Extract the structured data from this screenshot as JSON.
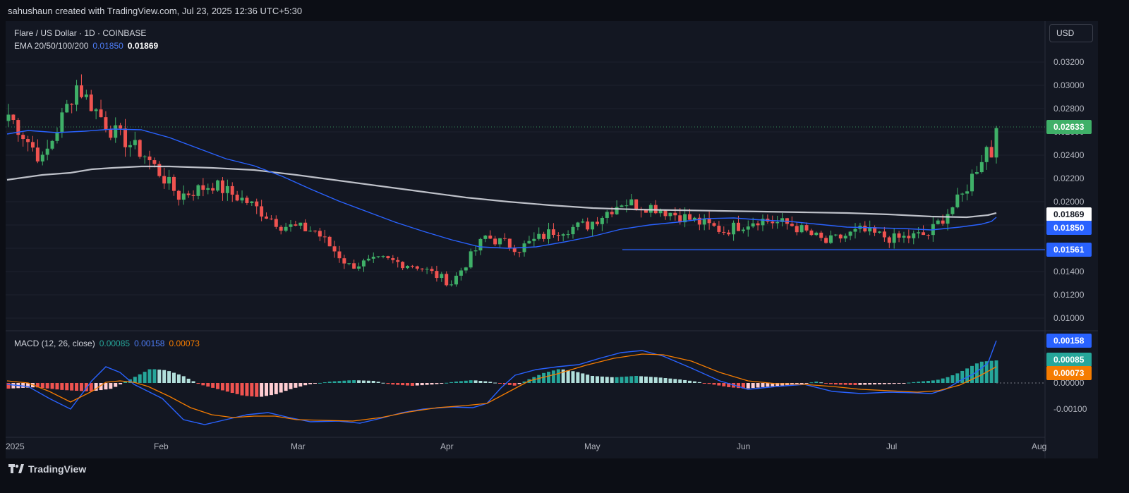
{
  "header": {
    "attribution": "sahushaun created with TradingView.com, Jul 23, 2025 12:36 UTC+5:30"
  },
  "price_pane": {
    "title": "Flare / US Dollar · 1D · COINBASE",
    "ema_label": "EMA 20/50/100/200",
    "ema_value_1": "0.01850",
    "ema_value_2": "0.01869",
    "currency_button": "USD",
    "axis_ticks": [
      "0.03200",
      "0.03000",
      "0.02800",
      "0.02600",
      "0.02400",
      "0.02200",
      "0.02000",
      "0.01800",
      "0.01600",
      "0.01400",
      "0.01200",
      "0.01000"
    ],
    "tags": {
      "last_price": "0.02633",
      "ema_200": "0.01869",
      "ema_50": "0.01850",
      "support": "0.01561"
    }
  },
  "macd_pane": {
    "label": "MACD (12, 26, close)",
    "hist_value": "0.00085",
    "macd_value": "0.00158",
    "signal_value": "0.00073",
    "axis_ticks": [
      "0.00100",
      "0.00000",
      "-0.00100"
    ],
    "tags": {
      "macd": "0.00158",
      "hist": "0.00085",
      "signal": "0.00073"
    }
  },
  "time_axis": [
    "2025",
    "Feb",
    "Mar",
    "Apr",
    "May",
    "Jun",
    "Jul",
    "Aug"
  ],
  "footer": {
    "logo_text": "TradingView"
  },
  "colors": {
    "up": "#26a69a",
    "up_candle": "#3fb068",
    "down": "#ef5350",
    "ema_blue": "#2962ff",
    "ema_white": "#d1d4dc",
    "signal_orange": "#f57c00",
    "support_line": "#2962ff"
  },
  "chart_data": {
    "type": "candlestick",
    "title": "Flare / US Dollar · 1D · COINBASE",
    "x_range": [
      "2025-01-01",
      "2025-07-23"
    ],
    "y_range": [
      0.009,
      0.0333
    ],
    "support_level": 0.01561,
    "last_close": 0.02633,
    "ema_series": [
      {
        "name": "EMA 50",
        "value": 0.0185
      },
      {
        "name": "EMA 200",
        "value": 0.01869
      }
    ],
    "candles_sampled": [
      {
        "date": "2025-01-01",
        "open": 0.027,
        "high": 0.0282,
        "low": 0.0262,
        "close": 0.0275
      },
      {
        "date": "2025-01-08",
        "open": 0.0275,
        "high": 0.028,
        "low": 0.0225,
        "close": 0.0235
      },
      {
        "date": "2025-01-15",
        "open": 0.024,
        "high": 0.033,
        "low": 0.0235,
        "close": 0.03
      },
      {
        "date": "2025-01-22",
        "open": 0.0295,
        "high": 0.03,
        "low": 0.025,
        "close": 0.0262
      },
      {
        "date": "2025-01-29",
        "open": 0.0262,
        "high": 0.029,
        "low": 0.023,
        "close": 0.024
      },
      {
        "date": "2025-02-05",
        "open": 0.024,
        "high": 0.0245,
        "low": 0.0175,
        "close": 0.0205
      },
      {
        "date": "2025-02-12",
        "open": 0.0205,
        "high": 0.0225,
        "low": 0.0195,
        "close": 0.0215
      },
      {
        "date": "2025-02-19",
        "open": 0.0215,
        "high": 0.023,
        "low": 0.02,
        "close": 0.02
      },
      {
        "date": "2025-02-26",
        "open": 0.02,
        "high": 0.0205,
        "low": 0.0175,
        "close": 0.018
      },
      {
        "date": "2025-03-05",
        "open": 0.018,
        "high": 0.0195,
        "low": 0.017,
        "close": 0.0175
      },
      {
        "date": "2025-03-12",
        "open": 0.0175,
        "high": 0.018,
        "low": 0.014,
        "close": 0.0145
      },
      {
        "date": "2025-03-19",
        "open": 0.0145,
        "high": 0.0155,
        "low": 0.014,
        "close": 0.015
      },
      {
        "date": "2025-03-26",
        "open": 0.015,
        "high": 0.0152,
        "low": 0.014,
        "close": 0.0145
      },
      {
        "date": "2025-04-02",
        "open": 0.0145,
        "high": 0.015,
        "low": 0.0125,
        "close": 0.013
      },
      {
        "date": "2025-04-09",
        "open": 0.0125,
        "high": 0.0175,
        "low": 0.011,
        "close": 0.017
      },
      {
        "date": "2025-04-16",
        "open": 0.017,
        "high": 0.019,
        "low": 0.0145,
        "close": 0.016
      },
      {
        "date": "2025-04-23",
        "open": 0.016,
        "high": 0.0185,
        "low": 0.0155,
        "close": 0.0175
      },
      {
        "date": "2025-04-30",
        "open": 0.0175,
        "high": 0.0195,
        "low": 0.017,
        "close": 0.018
      },
      {
        "date": "2025-05-07",
        "open": 0.018,
        "high": 0.0222,
        "low": 0.0178,
        "close": 0.02
      },
      {
        "date": "2025-05-14",
        "open": 0.02,
        "high": 0.021,
        "low": 0.019,
        "close": 0.0195
      },
      {
        "date": "2025-05-21",
        "open": 0.0195,
        "high": 0.02,
        "low": 0.018,
        "close": 0.0185
      },
      {
        "date": "2025-05-28",
        "open": 0.0185,
        "high": 0.0195,
        "low": 0.0165,
        "close": 0.0175
      },
      {
        "date": "2025-06-04",
        "open": 0.0175,
        "high": 0.0202,
        "low": 0.0172,
        "close": 0.0185
      },
      {
        "date": "2025-06-11",
        "open": 0.0185,
        "high": 0.0195,
        "low": 0.0178,
        "close": 0.018
      },
      {
        "date": "2025-06-18",
        "open": 0.018,
        "high": 0.0185,
        "low": 0.016,
        "close": 0.0165
      },
      {
        "date": "2025-06-25",
        "open": 0.0165,
        "high": 0.0185,
        "low": 0.016,
        "close": 0.0175
      },
      {
        "date": "2025-07-02",
        "open": 0.0175,
        "high": 0.018,
        "low": 0.0165,
        "close": 0.0168
      },
      {
        "date": "2025-07-09",
        "open": 0.0165,
        "high": 0.0175,
        "low": 0.0158,
        "close": 0.0172
      },
      {
        "date": "2025-07-16",
        "open": 0.0175,
        "high": 0.0225,
        "low": 0.0172,
        "close": 0.0205
      },
      {
        "date": "2025-07-23",
        "open": 0.024,
        "high": 0.0263,
        "low": 0.0238,
        "close": 0.02633
      }
    ]
  }
}
